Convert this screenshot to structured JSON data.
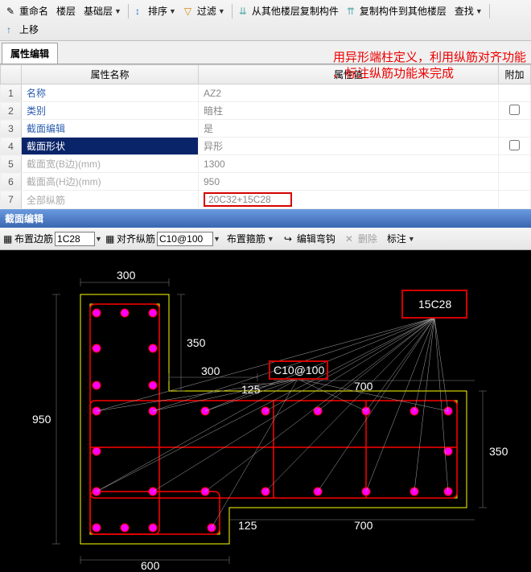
{
  "toolbar": {
    "rename": "重命名",
    "floor": "楼层",
    "base_layer": "基础层",
    "sort": "排序",
    "filter": "过滤",
    "copy_from": "从其他楼层复制构件",
    "copy_to": "复制构件到其他楼层",
    "find": "查找",
    "move_up": "上移"
  },
  "tab": {
    "prop_edit": "属性编辑"
  },
  "headers": {
    "name": "属性名称",
    "value": "属性值",
    "extra": "附加"
  },
  "rows": [
    {
      "num": "1",
      "name": "名称",
      "value": "AZ2",
      "chk": false,
      "editable": true
    },
    {
      "num": "2",
      "name": "类别",
      "value": "暗柱",
      "chk": true,
      "editable": true
    },
    {
      "num": "3",
      "name": "截面编辑",
      "value": "是",
      "chk": false,
      "editable": true
    },
    {
      "num": "4",
      "name": "截面形状",
      "value": "异形",
      "chk": true,
      "selected": true,
      "editable": true
    },
    {
      "num": "5",
      "name": "截面宽(B边)(mm)",
      "value": "1300",
      "chk": false,
      "editable": false
    },
    {
      "num": "6",
      "name": "截面高(H边)(mm)",
      "value": "950",
      "chk": false,
      "editable": false
    },
    {
      "num": "7",
      "name": "全部纵筋",
      "value": "20C32+15C28",
      "chk": false,
      "editable": false,
      "highlight": true
    }
  ],
  "annotation": {
    "line1": "用异形端柱定义，利用纵筋对齐功能",
    "line2": "、标注纵筋功能来完成"
  },
  "section_editor": {
    "title": "截面编辑",
    "layout_edge": "布置边筋",
    "edge_val": "1C28",
    "align": "对齐纵筋",
    "align_val": "C10@100",
    "layout_stirrup": "布置箍筋",
    "edit_hook": "编辑弯钩",
    "delete": "删除",
    "annotate": "标注"
  },
  "cad": {
    "label_15c28": "15C28",
    "label_c10": "C10@100",
    "dims": {
      "top_300": "300",
      "mid_350": "350",
      "mid_300": "300",
      "m125a": "125",
      "m700a": "700",
      "left_950": "950",
      "right_350": "350",
      "b125": "125",
      "b700": "700",
      "bot_600": "600"
    }
  }
}
